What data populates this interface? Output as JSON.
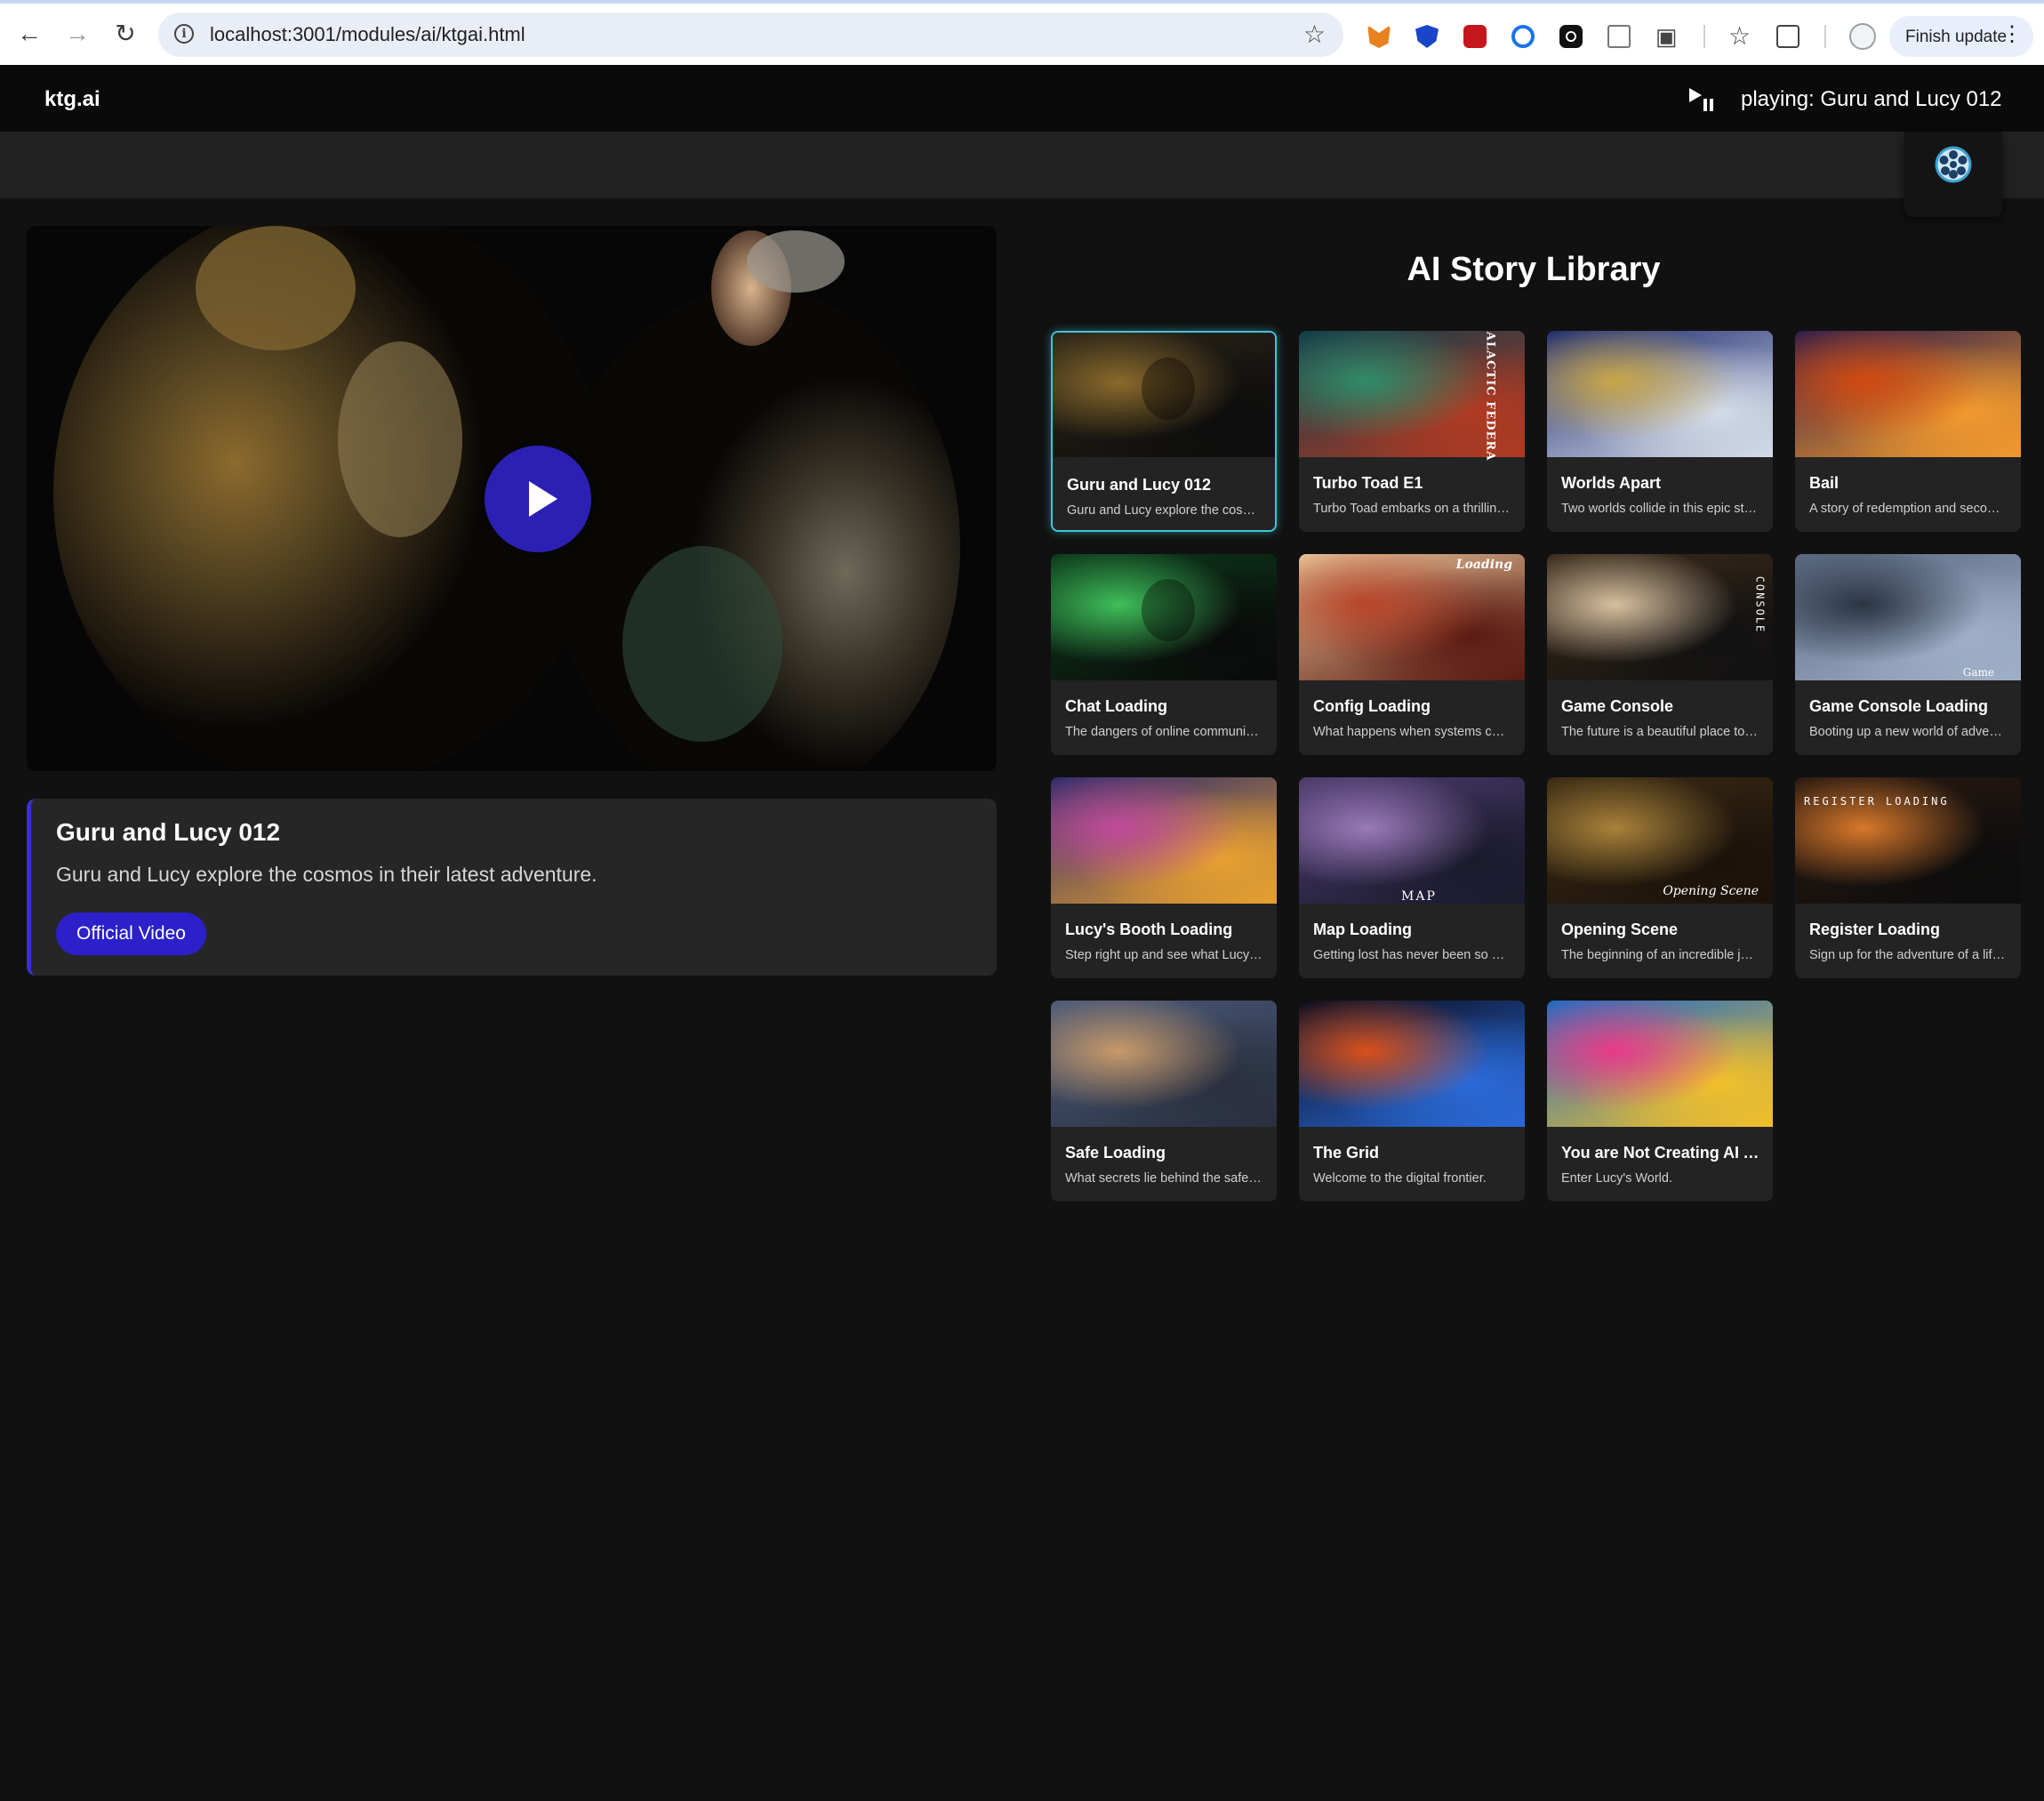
{
  "browser": {
    "url": "localhost:3001/modules/ai/ktgai.html",
    "finish_update": "Finish update"
  },
  "app": {
    "brand": "ktg.ai",
    "now_playing": "playing: Guru and Lucy 012"
  },
  "player": {
    "title": "Guru and Lucy 012",
    "description": "Guru and Lucy explore the cosmos in their latest adventure.",
    "button_label": "Official Video"
  },
  "library": {
    "title": "AI Story Library",
    "items": [
      {
        "title": "Guru and Lucy 012",
        "desc": "Guru and Lucy explore the cosmos in their latest adventure.",
        "active": true,
        "palette": [
          "#2a2418",
          "#8a6a2c",
          "#0d0d0d"
        ],
        "thumb_text": ""
      },
      {
        "title": "Turbo Toad E1",
        "desc": "Turbo Toad embarks on a thrilling adventure.",
        "active": false,
        "palette": [
          "#0f3b4a",
          "#2f8c6a",
          "#b13a22"
        ],
        "thumb_text": "GALACTIC FEDERA"
      },
      {
        "title": "Worlds Apart",
        "desc": "Two worlds collide in this epic story.",
        "active": false,
        "palette": [
          "#1c2a6e",
          "#c9a648",
          "#d4dbe8"
        ],
        "thumb_text": ""
      },
      {
        "title": "Bail",
        "desc": "A story of redemption and second chances.",
        "active": false,
        "palette": [
          "#2c1c4a",
          "#d14a12",
          "#f29a2e"
        ],
        "thumb_text": ""
      },
      {
        "title": "Chat Loading",
        "desc": "The dangers of online communication.",
        "active": false,
        "palette": [
          "#0c3a1c",
          "#3fbf5a",
          "#0a0a0a"
        ],
        "thumb_text": ""
      },
      {
        "title": "Config Loading",
        "desc": "What happens when systems collide.",
        "active": false,
        "palette": [
          "#e9c59a",
          "#b8452a",
          "#5a1a12"
        ],
        "thumb_text": "Loading"
      },
      {
        "title": "Game Console",
        "desc": "The future is a beautiful place to play.",
        "active": false,
        "palette": [
          "#3a2a1a",
          "#d8c0a0",
          "#111111"
        ],
        "thumb_text": "CONSOLE"
      },
      {
        "title": "Game Console Loading",
        "desc": "Booting up a new world of adventure.",
        "active": false,
        "palette": [
          "#5b6a82",
          "#2a3444",
          "#9fb0c8"
        ],
        "thumb_text": "Game"
      },
      {
        "title": "Lucy's Booth Loading",
        "desc": "Step right up and see what Lucy has in store.",
        "active": false,
        "palette": [
          "#2a2a6a",
          "#c04a9a",
          "#e8a030"
        ],
        "thumb_text": ""
      },
      {
        "title": "Map Loading",
        "desc": "Getting lost has never been so much fun.",
        "active": false,
        "palette": [
          "#4a3a6a",
          "#9a7ab8",
          "#1a1a2e"
        ],
        "thumb_text": "MAP"
      },
      {
        "title": "Opening Scene",
        "desc": "The beginning of an incredible journey.",
        "active": false,
        "palette": [
          "#3a2a14",
          "#a8823a",
          "#1a120a"
        ],
        "thumb_text": "Opening Scene"
      },
      {
        "title": "Register Loading",
        "desc": "Sign up for the adventure of a lifetime.",
        "active": false,
        "palette": [
          "#2a1a12",
          "#d8782a",
          "#0d0d0d"
        ],
        "thumb_text": "REGISTER LOADING"
      },
      {
        "title": "Safe Loading",
        "desc": "What secrets lie behind the safe door?",
        "active": false,
        "palette": [
          "#4a5a7a",
          "#c89a6a",
          "#2a3040"
        ],
        "thumb_text": ""
      },
      {
        "title": "The Grid",
        "desc": "Welcome to the digital frontier.",
        "active": false,
        "palette": [
          "#0a0a1a",
          "#d8501a",
          "#2a6ad8"
        ],
        "thumb_text": ""
      },
      {
        "title": "You are Not Creating AI Art",
        "desc": "Enter Lucy's World.",
        "active": false,
        "palette": [
          "#1a6ac8",
          "#e83a8a",
          "#f2c02a"
        ],
        "thumb_text": ""
      }
    ]
  }
}
